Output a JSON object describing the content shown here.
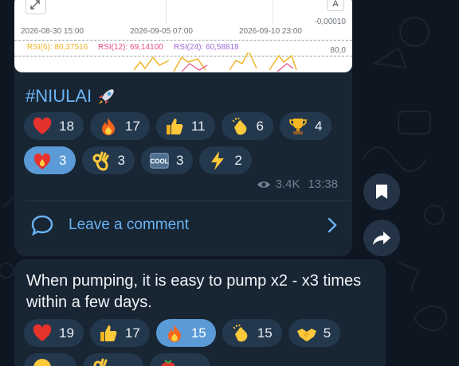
{
  "chart": {
    "x_ticks": [
      "2026-08-30 15:00",
      "2026-09-05 07:00",
      "2026-09-10 23:00"
    ],
    "y_right_top": "-0,00010",
    "y_right_bottom": "80,0",
    "a_label": "A",
    "rsi6": "RSI(6): 80,37516",
    "rsi12": "RSI(12): 69,14100",
    "rsi24": "RSI(24): 60,58818",
    "colors": {
      "rsi6": "#f0b429",
      "rsi12": "#e84a8a",
      "rsi24": "#a26bd6"
    }
  },
  "post1": {
    "hashtag": "#NIULAI",
    "reactions_row1": [
      {
        "icon": "heart-icon",
        "count": "18"
      },
      {
        "icon": "fire-icon",
        "count": "17"
      },
      {
        "icon": "thumbs-up-icon",
        "count": "11"
      },
      {
        "icon": "clap-icon",
        "count": "6"
      },
      {
        "icon": "trophy-icon",
        "count": "4"
      }
    ],
    "reactions_row2": [
      {
        "icon": "heart-on-fire-icon",
        "count": "3",
        "active": true
      },
      {
        "icon": "ok-hand-icon",
        "count": "3"
      },
      {
        "icon": "cool-icon",
        "count": "3",
        "badge": "COOL"
      },
      {
        "icon": "lightning-icon",
        "count": "2"
      }
    ],
    "views": "3.4K",
    "time": "13:38",
    "comment_label": "Leave a comment"
  },
  "post2": {
    "text": "When pumping, it is easy to pump x2 - x3 times within a few days.",
    "reactions_row1": [
      {
        "icon": "heart-icon",
        "count": "19"
      },
      {
        "icon": "thumbs-up-icon",
        "count": "17"
      },
      {
        "icon": "fire-icon",
        "count": "15",
        "active": true
      },
      {
        "icon": "clap-icon",
        "count": "15"
      },
      {
        "icon": "handshake-icon",
        "count": "5"
      }
    ]
  },
  "theme": {
    "accent": "#6ab3f3",
    "bubble": "#182533",
    "bg": "#0e1621"
  }
}
